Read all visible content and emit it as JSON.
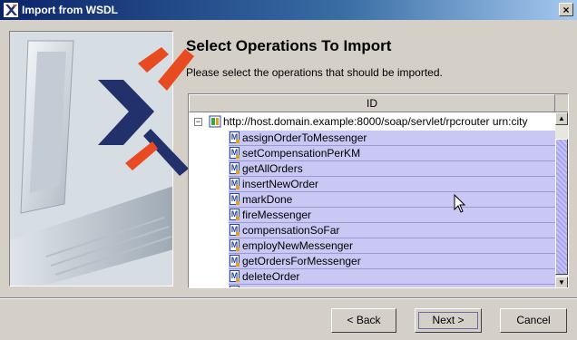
{
  "window": {
    "title": "Import from WSDL",
    "close_label": "×"
  },
  "page": {
    "heading": "Select Operations To Import",
    "subtitle": "Please select the operations that should be imported."
  },
  "table": {
    "column_header": "ID",
    "root": {
      "label": "http://host.domain.example:8000/soap/servlet/rpcrouter urn:city",
      "expander": "−"
    },
    "operations": [
      "assignOrderToMessenger",
      "setCompensationPerKM",
      "getAllOrders",
      "insertNewOrder",
      "markDone",
      "fireMessenger",
      "compensationSoFar",
      "employNewMessenger",
      "getOrdersForMessenger",
      "deleteOrder",
      ""
    ],
    "operation_icon_glyph": "M",
    "scrollbar": {
      "up": "▲",
      "down": "▼"
    }
  },
  "buttons": {
    "back": "< Back",
    "next": "Next >",
    "cancel": "Cancel"
  },
  "colors": {
    "title_bar": "#0a246a",
    "selection": "#c9c7f3",
    "logo_red": "#e84b22",
    "logo_navy": "#22306b"
  },
  "icons": {
    "app": "x-logo-icon",
    "operation": "method-icon",
    "root": "service-icon"
  }
}
